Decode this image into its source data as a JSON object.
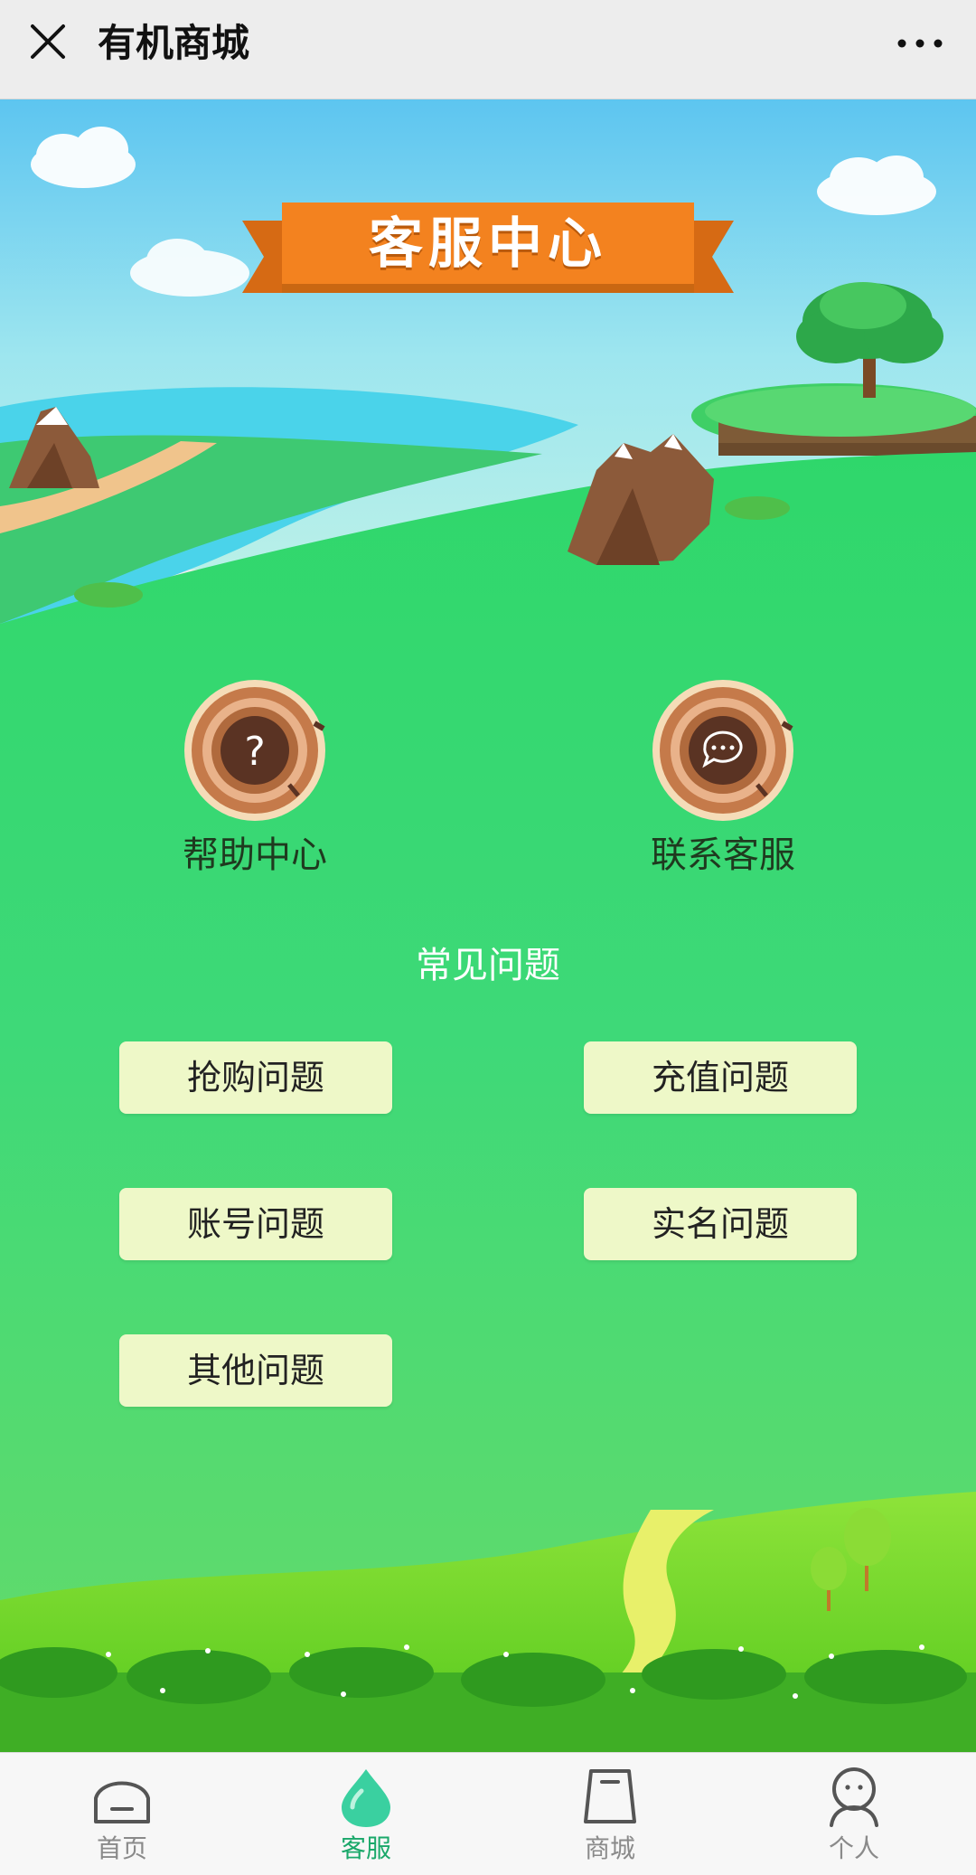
{
  "header": {
    "title": "有机商城"
  },
  "banner": {
    "title": "客服中心"
  },
  "services": [
    {
      "label": "帮助中心",
      "icon": "question-icon"
    },
    {
      "label": "联系客服",
      "icon": "chat-icon"
    }
  ],
  "faq": {
    "title": "常见问题",
    "items": [
      "抢购问题",
      "充值问题",
      "账号问题",
      "实名问题",
      "其他问题"
    ]
  },
  "nav": {
    "items": [
      {
        "label": "首页",
        "icon": "home-icon",
        "active": false
      },
      {
        "label": "客服",
        "icon": "droplet-icon",
        "active": true
      },
      {
        "label": "商城",
        "icon": "bag-icon",
        "active": false
      },
      {
        "label": "个人",
        "icon": "person-icon",
        "active": false
      }
    ]
  },
  "colors": {
    "active": "#1aa86a",
    "inactive": "#8a8a8a",
    "faq_button": "#eef8c8",
    "banner": "#f3821f"
  }
}
